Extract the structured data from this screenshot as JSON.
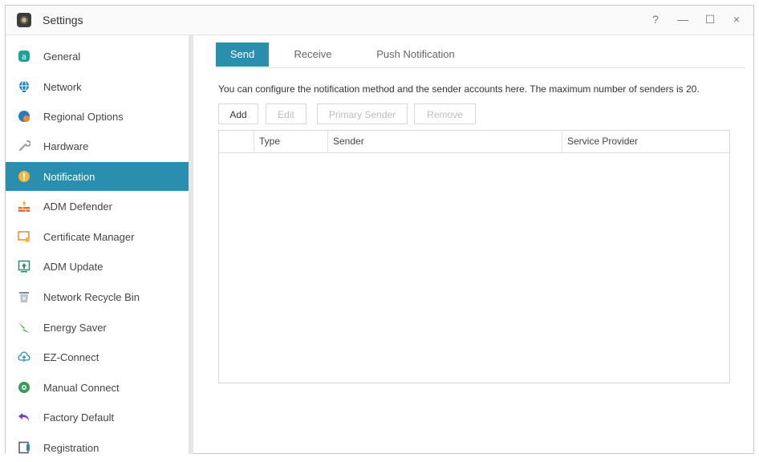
{
  "window": {
    "title": "Settings",
    "help_glyph": "?",
    "minimize_glyph": "—",
    "maximize_glyph": "☐",
    "close_glyph": "×"
  },
  "sidebar": {
    "items": [
      {
        "label": "General",
        "icon": "general-icon",
        "color": "#1aa39a"
      },
      {
        "label": "Network",
        "icon": "globe-icon",
        "color": "#1e88c8"
      },
      {
        "label": "Regional Options",
        "icon": "regional-icon",
        "color": "#2b78c5"
      },
      {
        "label": "Hardware",
        "icon": "wrench-icon",
        "color": "#9a9a9a"
      },
      {
        "label": "Notification",
        "icon": "notification-icon",
        "color": "#f4b63b",
        "active": true
      },
      {
        "label": "ADM Defender",
        "icon": "firewall-icon",
        "color": "#e66a2c"
      },
      {
        "label": "Certificate Manager",
        "icon": "certificate-icon",
        "color": "#f08a24"
      },
      {
        "label": "ADM Update",
        "icon": "update-icon",
        "color": "#2c8a6a"
      },
      {
        "label": "Network Recycle Bin",
        "icon": "recycle-bin-icon",
        "color": "#7b8b93"
      },
      {
        "label": "Energy Saver",
        "icon": "energy-icon",
        "color": "#4bb34b"
      },
      {
        "label": "EZ-Connect",
        "icon": "cloud-icon",
        "color": "#2a8fae"
      },
      {
        "label": "Manual Connect",
        "icon": "connect-icon",
        "color": "#3a9a5a"
      },
      {
        "label": "Factory Default",
        "icon": "undo-icon",
        "color": "#7a3fb5"
      },
      {
        "label": "Registration",
        "icon": "registration-icon",
        "color": "#555555"
      }
    ]
  },
  "tabs": [
    {
      "label": "Send",
      "active": true
    },
    {
      "label": "Receive"
    },
    {
      "label": "Push Notification"
    }
  ],
  "description": "You can configure the notification method and the sender accounts here. The maximum number of senders is 20.",
  "toolbar": {
    "add": "Add",
    "edit": "Edit",
    "primary_sender": "Primary Sender",
    "remove": "Remove"
  },
  "table": {
    "columns": [
      "",
      "Type",
      "Sender",
      "Service Provider"
    ],
    "rows": []
  },
  "colors": {
    "accent": "#2a8fae"
  }
}
